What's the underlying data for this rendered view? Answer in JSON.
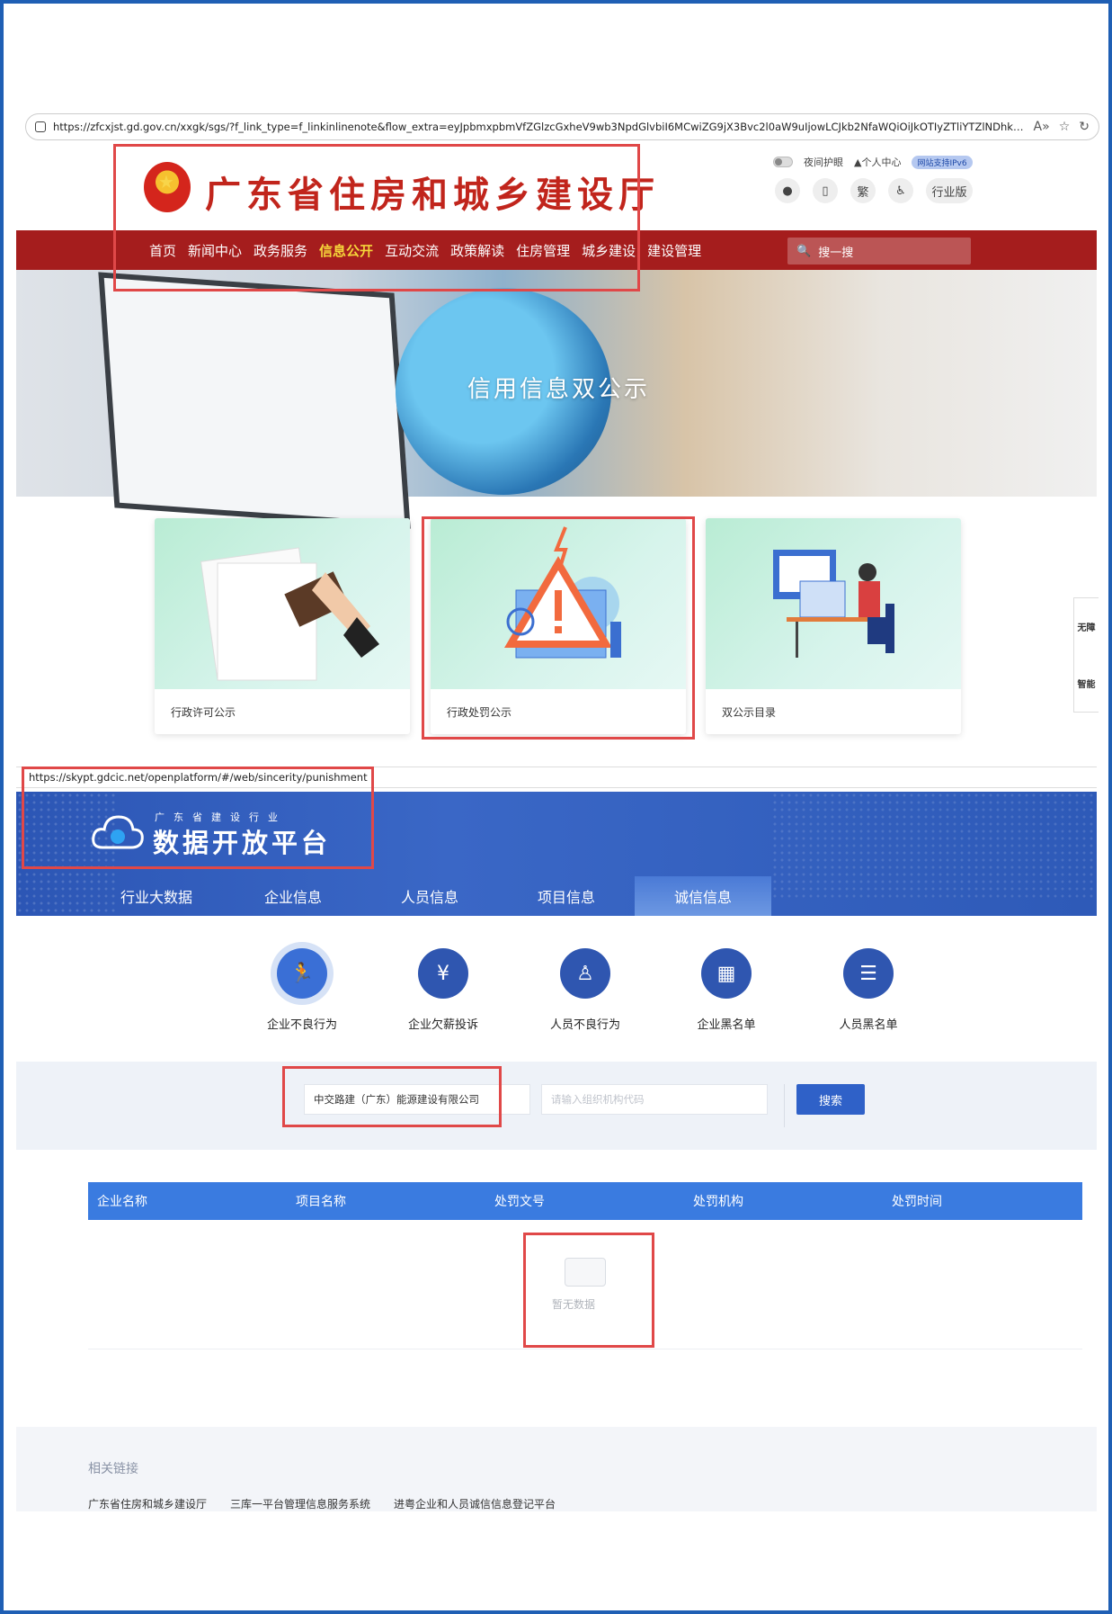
{
  "browser1": {
    "url": "https://zfcxjst.gd.gov.cn/xxgk/sgs/?f_link_type=f_linkinlinenote&flow_extra=eyJpbmxpbmVfZGlzcGxheV9wb3NpdGlvbiI6MCwiZG9jX3Bvc2l0aW9uIjowLCJkb2NfaWQiOiJkOTIyZTliYTZlNDhkNGQwLTk4YzAwOTdmOWY3MjRkO..."
  },
  "gov": {
    "title": "广东省住房和城乡建设厅",
    "night_mode": "夜间护眼",
    "personal_center": "个人中心",
    "ipv6": "网站支持IPv6",
    "traditional": "繁",
    "industry": "行业版",
    "nav": [
      "首页",
      "新闻中心",
      "政务服务",
      "信息公开",
      "互动交流",
      "政策解读",
      "住房管理",
      "城乡建设",
      "建设管理"
    ],
    "active_nav": "信息公开",
    "search_placeholder": "搜一搜",
    "banner_text": "信用信息双公示",
    "cards": [
      "行政许可公示",
      "行政处罚公示",
      "双公示目录"
    ],
    "side_tabs": [
      "无障",
      "智能"
    ]
  },
  "browser2": {
    "url": "https://skypt.gdcic.net/openplatform/#/web/sincerity/punishment"
  },
  "platform": {
    "subtitle": "广东省建设行业",
    "title": "数据开放平台",
    "nav": [
      "行业大数据",
      "企业信息",
      "人员信息",
      "项目信息",
      "诚信信息"
    ],
    "active_nav": "诚信信息",
    "categories": [
      "企业不良行为",
      "企业欠薪投诉",
      "人员不良行为",
      "企业黑名单",
      "人员黑名单"
    ],
    "company_input": "中交路建（广东）能源建设有限公司",
    "org_code_placeholder": "请输入组织机构代码",
    "search_button": "搜索",
    "table_headers": [
      "企业名称",
      "项目名称",
      "处罚文号",
      "处罚机构",
      "处罚时间"
    ],
    "empty_text": "暂无数据",
    "footer_title": "相关链接",
    "footer_links": [
      "广东省住房和城乡建设厅",
      "三库一平台管理信息服务系统",
      "进粤企业和人员诚信信息登记平台"
    ]
  }
}
